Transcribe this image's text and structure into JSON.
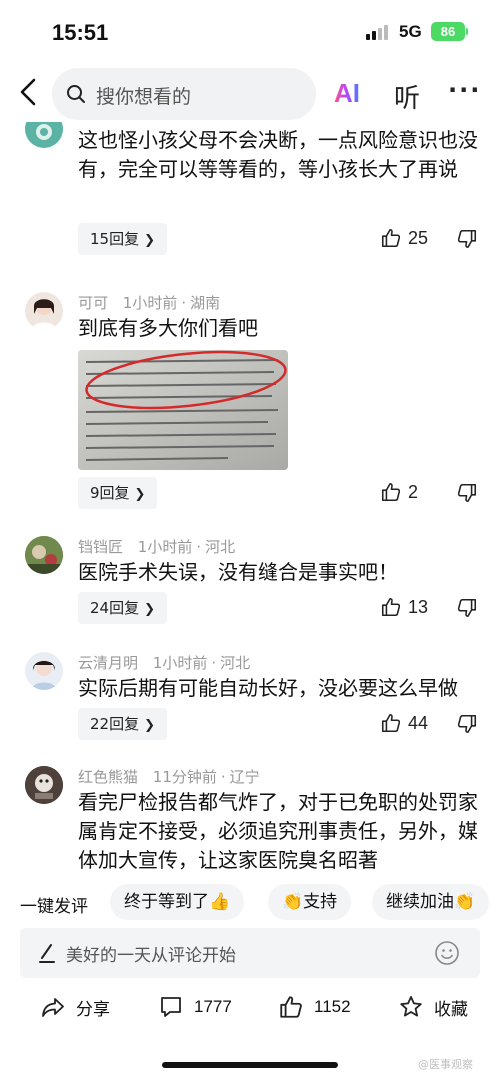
{
  "status_bar": {
    "time": "15:51",
    "network": "5G",
    "battery": "86"
  },
  "top_nav": {
    "search_placeholder": "搜你想看的",
    "ai_label": "AI",
    "listen_label": "听",
    "more_label": "···"
  },
  "comments": [
    {
      "user": "",
      "time": "",
      "location": "",
      "text": "这也怪小孩父母不会决断，一点风险意识也没有，完全可以等等看的，等小孩长大了再说",
      "replies": "15回复",
      "likes": "25"
    },
    {
      "user": "可可",
      "time": "1小时前",
      "location": "湖南",
      "text": "到底有多大你们看吧",
      "replies": "9回复",
      "likes": "2"
    },
    {
      "user": "铛铛匠",
      "time": "1小时前",
      "location": "河北",
      "text": "医院手术失误，没有缝合是事实吧！",
      "replies": "24回复",
      "likes": "13"
    },
    {
      "user": "云清月明",
      "time": "1小时前",
      "location": "河北",
      "text": "实际后期有可能自动长好，没必要这么早做",
      "replies": "22回复",
      "likes": "44"
    },
    {
      "user": "红色熊猫",
      "time": "11分钟前",
      "location": "辽宁",
      "text": "看完尸检报告都气炸了，对于已免职的处罚家属肯定不接受，必须追究刑事责任，另外，媒体加大宣传，让这家医院臭名昭著",
      "replies": "",
      "likes": ""
    }
  ],
  "quick_comments": {
    "label": "一键发评",
    "chips": [
      "终于等到了",
      "支持",
      "继续加油"
    ],
    "chip_emojis": [
      "👍",
      "👏",
      "👏"
    ]
  },
  "comment_input": {
    "placeholder": "美好的一天从评论开始"
  },
  "actions": {
    "share": "分享",
    "comments": "1777",
    "likes": "1152",
    "favorite": "收藏"
  },
  "watermark": "@医事观察",
  "colors": {
    "ai_gradient": [
      "#ff4f8a",
      "#b04bff",
      "#4a7bff"
    ],
    "battery": "#4cd964",
    "meta_text": "#999999"
  },
  "icons": [
    "back-icon",
    "search-icon",
    "thumbs-up-icon",
    "thumbs-down-icon",
    "pen-icon",
    "smile-icon",
    "share-icon",
    "comment-icon",
    "star-icon"
  ]
}
